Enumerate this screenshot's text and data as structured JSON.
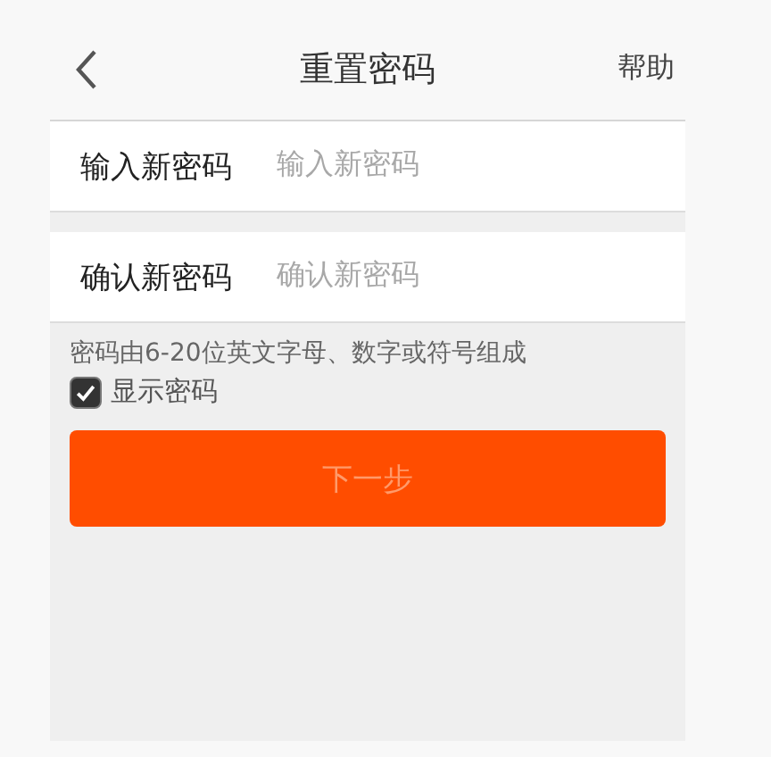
{
  "nav": {
    "title": "重置密码",
    "help": "帮助"
  },
  "fields": [
    {
      "label": "输入新密码",
      "placeholder": "输入新密码"
    },
    {
      "label": "确认新密码",
      "placeholder": "确认新密码"
    }
  ],
  "hint": "密码由6-20位英文字母、数字或符号组成",
  "show_password": {
    "label": "显示密码",
    "checked": true
  },
  "next_button": {
    "label": "下一步",
    "disabled": true
  }
}
